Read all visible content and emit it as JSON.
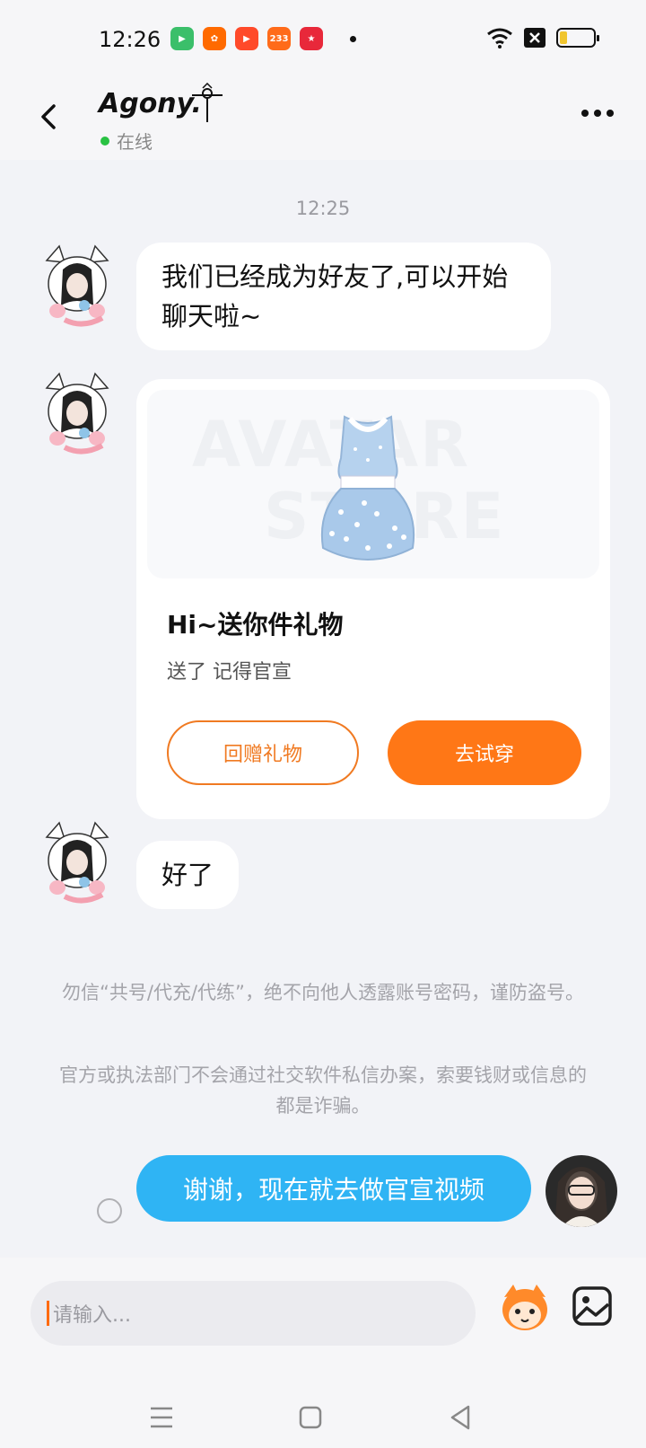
{
  "status_bar": {
    "time": "12:26",
    "app_icons": [
      {
        "name": "video-app-icon",
        "color": "#3bbf6a",
        "label": ""
      },
      {
        "name": "kuaishou-icon",
        "color": "#ff6a00",
        "label": ""
      },
      {
        "name": "play-app-icon",
        "color": "#ff4a2a",
        "label": ""
      },
      {
        "name": "233-app-icon",
        "color": "#ff6b1a",
        "label": "233"
      },
      {
        "name": "game-app-icon",
        "color": "#e8283a",
        "label": ""
      }
    ]
  },
  "header": {
    "back_icon": "chevron-left-icon",
    "contact_name": "Agony.",
    "online_status": "在线",
    "more_icon": "more-horizontal-icon"
  },
  "chat": {
    "timestamp": "12:25",
    "messages": [
      {
        "text": "我们已经成为好友了,可以开始聊天啦~"
      },
      {
        "text": "好了"
      }
    ],
    "gift": {
      "watermark_1": "AVATAR",
      "watermark_2": "STORE",
      "title": "Hi~送你件礼物",
      "subtitle": "送了 记得官宣",
      "return_button": "回赠礼物",
      "try_button": "去试穿"
    },
    "notices": [
      "勿信“共号/代充/代练”，绝不向他人透露账号密码，谨防盗号。",
      "官方或执法部门不会通过社交软件私信办案，索要钱财或信息的都是诈骗。"
    ],
    "my_message": "谢谢，现在就去做官宣视频"
  },
  "input_bar": {
    "placeholder": "请输入...",
    "emoji_icon": "emoji-mascot-icon",
    "image_icon": "image-icon"
  },
  "colors": {
    "accent_orange": "#ff7716",
    "my_bubble_blue": "#2fb4f4",
    "online_green": "#29c243"
  }
}
